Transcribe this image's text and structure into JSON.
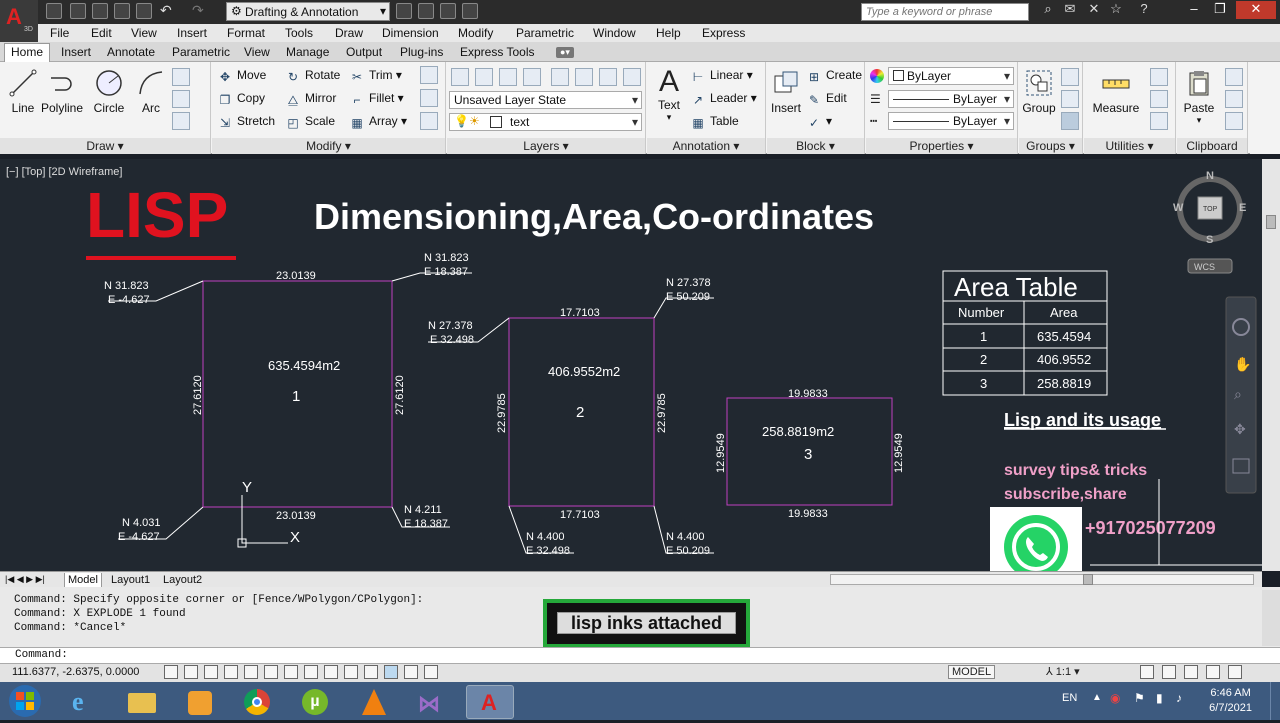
{
  "app": {
    "workspace": "Drafting & Annotation",
    "search_placeholder": "Type a keyword or phrase",
    "logo_sub": "3D"
  },
  "menubar": [
    "File",
    "Edit",
    "View",
    "Insert",
    "Format",
    "Tools",
    "Draw",
    "Dimension",
    "Modify",
    "Parametric",
    "Window",
    "Help",
    "Express"
  ],
  "tabs": [
    "Home",
    "Insert",
    "Annotate",
    "Parametric",
    "View",
    "Manage",
    "Output",
    "Plug-ins",
    "Express Tools"
  ],
  "ribbon": {
    "draw": {
      "title": "Draw",
      "line": "Line",
      "polyline": "Polyline",
      "circle": "Circle",
      "arc": "Arc"
    },
    "modify": {
      "title": "Modify",
      "move": "Move",
      "rotate": "Rotate",
      "trim": "Trim",
      "copy": "Copy",
      "mirror": "Mirror",
      "fillet": "Fillet",
      "stretch": "Stretch",
      "scale": "Scale",
      "array": "Array"
    },
    "layers": {
      "title": "Layers",
      "layer_state": "Unsaved Layer State",
      "current_layer": "text"
    },
    "annotation": {
      "title": "Annotation",
      "text": "Text",
      "linear": "Linear",
      "leader": "Leader",
      "table": "Table"
    },
    "block": {
      "title": "Block",
      "insert": "Insert",
      "create": "Create",
      "edit": "Edit"
    },
    "properties": {
      "title": "Properties",
      "color": "ByLayer",
      "linetype": "ByLayer",
      "lineweight": "ByLayer"
    },
    "groups": {
      "title": "Groups",
      "group": "Group"
    },
    "utilities": {
      "title": "Utilities",
      "measure": "Measure"
    },
    "clipboard": {
      "title": "Clipboard",
      "paste": "Paste"
    }
  },
  "viewport": {
    "label": "[−] [Top] [2D Wireframe]",
    "cube_top": "TOP",
    "compass": {
      "n": "N",
      "s": "S",
      "e": "E",
      "w": "W"
    },
    "wcs": "WCS"
  },
  "drawing": {
    "lisp_title": "LISP",
    "main_title": "Dimensioning,Area,Co-ordinates",
    "plots": [
      {
        "area": "635.4594m2",
        "number": "1",
        "top": "23.0139",
        "bottom": "23.0139",
        "left": "27.6120",
        "right": "27.6120",
        "coords": [
          {
            "n": "N 31.823",
            "e": "E -4.627"
          },
          {
            "n": "N 31.823",
            "e": "E 18.387"
          },
          {
            "n": "N 4.031",
            "e": "E -4.627"
          },
          {
            "n": "N 4.211",
            "e": "E 18.387"
          }
        ]
      },
      {
        "area": "406.9552m2",
        "number": "2",
        "top": "17.7103",
        "bottom": "17.7103",
        "left": "22.9785",
        "right": "22.9785",
        "coords": [
          {
            "n": "N 27.378",
            "e": "E 32.498"
          },
          {
            "n": "N 27.378",
            "e": "E 50.209"
          },
          {
            "n": "N 4.400",
            "e": "E 32.498"
          },
          {
            "n": "N 4.400",
            "e": "E 50.209"
          }
        ]
      },
      {
        "area": "258.8819m2",
        "number": "3",
        "top": "19.9833",
        "bottom": "19.9833",
        "left": "12.9549",
        "right": "12.9549"
      }
    ],
    "area_table": {
      "title": "Area Table",
      "headers": [
        "Number",
        "Area"
      ],
      "rows": [
        [
          "1",
          "635.4594"
        ],
        [
          "2",
          "406.9552"
        ],
        [
          "3",
          "258.8819"
        ]
      ]
    },
    "lisp_usage": "Lisp and its usage",
    "promo_line1": "survey tips& tricks",
    "promo_line2": "subscribe,share",
    "phone": "+917025077209",
    "ucs_y": "Y",
    "ucs_x": "X"
  },
  "layout_tabs": [
    "Model",
    "Layout1",
    "Layout2"
  ],
  "command": {
    "history": [
      "Command: Specify opposite corner or [Fence/WPolygon/CPolygon]:",
      "Command: X EXPLODE 1 found",
      "Command: *Cancel*"
    ],
    "prompt": "Command:",
    "overlay": "lisp inks attached"
  },
  "status": {
    "coords": "111.6377, -2.6375, 0.0000",
    "model": "MODEL",
    "scale": "1:1"
  },
  "taskbar": {
    "lang": "EN",
    "time": "6:46 AM",
    "date": "6/7/2021"
  },
  "colors": {
    "plot_lines": "#c040c0",
    "lisp_red": "#e0121f",
    "promo_pink": "#f0a0c8",
    "whatsapp": "#25d366"
  }
}
